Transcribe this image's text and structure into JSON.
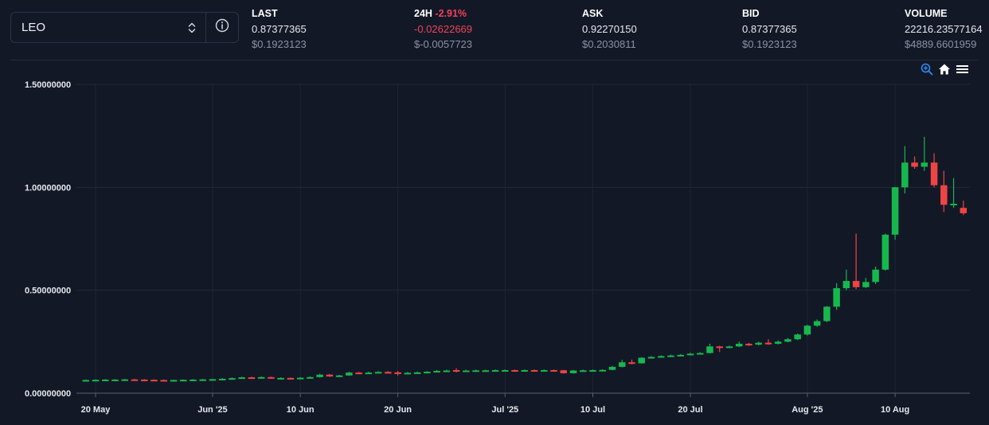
{
  "market_selector": {
    "value": "LEO"
  },
  "stats": [
    {
      "label": "LAST",
      "change": "",
      "value": "0.87377365",
      "usd": "$0.1923123"
    },
    {
      "label": "24H",
      "change": "-2.91%",
      "value": "-0.02622669",
      "usd": "$-0.0057723"
    },
    {
      "label": "ASK",
      "change": "",
      "value": "0.92270150",
      "usd": "$0.2030811"
    },
    {
      "label": "BID",
      "change": "",
      "value": "0.87377365",
      "usd": "$0.1923123"
    },
    {
      "label": "VOLUME",
      "change": "",
      "value": "22216.23577164",
      "usd": "$4889.6601959"
    }
  ],
  "toolbar": {
    "icons": [
      "zoom-in-icon",
      "home-icon",
      "menu-icon"
    ]
  },
  "colors": {
    "up": "#16b84e",
    "down": "#ef4444",
    "background": "#131826",
    "negative_text": "#f0435a",
    "zoom_icon": "#2f8cf0"
  },
  "chart_data": {
    "type": "candlestick",
    "title": "",
    "xlabel": "",
    "ylabel": "",
    "ylim": [
      0,
      1.5
    ],
    "y_ticks": [
      "0.00000000",
      "0.50000000",
      "1.00000000",
      "1.50000000"
    ],
    "x_ticks": [
      {
        "label": "20 May",
        "day": 0
      },
      {
        "label": "Jun '25",
        "day": 12
      },
      {
        "label": "10 Jun",
        "day": 21
      },
      {
        "label": "20 Jun",
        "day": 31
      },
      {
        "label": "Jul '25",
        "day": 42
      },
      {
        "label": "10 Jul",
        "day": 51
      },
      {
        "label": "20 Jul",
        "day": 61
      },
      {
        "label": "Aug '25",
        "day": 73
      },
      {
        "label": "10 Aug",
        "day": 82
      }
    ],
    "candles": [
      [
        -1,
        0.063,
        0.064,
        0.066,
        0.062
      ],
      [
        0,
        0.064,
        0.065,
        0.067,
        0.063
      ],
      [
        1,
        0.065,
        0.066,
        0.068,
        0.064
      ],
      [
        2,
        0.066,
        0.066,
        0.068,
        0.064
      ],
      [
        3,
        0.066,
        0.067,
        0.069,
        0.065
      ],
      [
        4,
        0.067,
        0.066,
        0.069,
        0.064
      ],
      [
        5,
        0.066,
        0.065,
        0.068,
        0.063
      ],
      [
        6,
        0.065,
        0.064,
        0.067,
        0.062
      ],
      [
        7,
        0.064,
        0.063,
        0.066,
        0.061
      ],
      [
        8,
        0.063,
        0.064,
        0.066,
        0.062
      ],
      [
        9,
        0.064,
        0.065,
        0.067,
        0.063
      ],
      [
        10,
        0.065,
        0.066,
        0.068,
        0.063
      ],
      [
        11,
        0.066,
        0.067,
        0.069,
        0.064
      ],
      [
        12,
        0.067,
        0.068,
        0.07,
        0.066
      ],
      [
        13,
        0.068,
        0.07,
        0.073,
        0.066
      ],
      [
        14,
        0.07,
        0.073,
        0.076,
        0.068
      ],
      [
        15,
        0.073,
        0.077,
        0.08,
        0.071
      ],
      [
        16,
        0.077,
        0.075,
        0.08,
        0.073
      ],
      [
        17,
        0.075,
        0.078,
        0.081,
        0.073
      ],
      [
        18,
        0.078,
        0.072,
        0.08,
        0.07
      ],
      [
        19,
        0.072,
        0.074,
        0.077,
        0.07
      ],
      [
        20,
        0.074,
        0.073,
        0.076,
        0.071
      ],
      [
        21,
        0.073,
        0.075,
        0.078,
        0.071
      ],
      [
        22,
        0.075,
        0.078,
        0.081,
        0.073
      ],
      [
        23,
        0.078,
        0.09,
        0.094,
        0.076
      ],
      [
        24,
        0.09,
        0.081,
        0.093,
        0.079
      ],
      [
        25,
        0.081,
        0.086,
        0.089,
        0.079
      ],
      [
        26,
        0.086,
        0.1,
        0.104,
        0.084
      ],
      [
        27,
        0.1,
        0.098,
        0.103,
        0.095
      ],
      [
        28,
        0.098,
        0.1,
        0.104,
        0.096
      ],
      [
        29,
        0.1,
        0.103,
        0.106,
        0.098
      ],
      [
        30,
        0.103,
        0.101,
        0.107,
        0.099
      ],
      [
        31,
        0.101,
        0.096,
        0.108,
        0.085
      ],
      [
        32,
        0.096,
        0.099,
        0.103,
        0.094
      ],
      [
        33,
        0.099,
        0.101,
        0.105,
        0.097
      ],
      [
        34,
        0.101,
        0.104,
        0.107,
        0.099
      ],
      [
        35,
        0.104,
        0.108,
        0.112,
        0.102
      ],
      [
        36,
        0.108,
        0.11,
        0.114,
        0.105
      ],
      [
        37,
        0.112,
        0.108,
        0.121,
        0.101
      ],
      [
        38,
        0.108,
        0.11,
        0.114,
        0.106
      ],
      [
        39,
        0.11,
        0.111,
        0.114,
        0.108
      ],
      [
        40,
        0.111,
        0.111,
        0.114,
        0.108
      ],
      [
        41,
        0.111,
        0.112,
        0.115,
        0.109
      ],
      [
        42,
        0.112,
        0.112,
        0.115,
        0.109
      ],
      [
        43,
        0.112,
        0.111,
        0.115,
        0.108
      ],
      [
        44,
        0.111,
        0.112,
        0.115,
        0.109
      ],
      [
        45,
        0.112,
        0.111,
        0.115,
        0.108
      ],
      [
        46,
        0.111,
        0.112,
        0.115,
        0.109
      ],
      [
        47,
        0.112,
        0.111,
        0.115,
        0.108
      ],
      [
        48,
        0.111,
        0.097,
        0.113,
        0.095
      ],
      [
        49,
        0.097,
        0.11,
        0.113,
        0.095
      ],
      [
        50,
        0.11,
        0.111,
        0.114,
        0.108
      ],
      [
        51,
        0.111,
        0.112,
        0.115,
        0.109
      ],
      [
        52,
        0.112,
        0.113,
        0.116,
        0.11
      ],
      [
        53,
        0.113,
        0.128,
        0.132,
        0.111
      ],
      [
        54,
        0.128,
        0.15,
        0.162,
        0.125
      ],
      [
        55,
        0.15,
        0.145,
        0.163,
        0.14
      ],
      [
        56,
        0.145,
        0.172,
        0.175,
        0.143
      ],
      [
        57,
        0.172,
        0.176,
        0.18,
        0.17
      ],
      [
        58,
        0.176,
        0.18,
        0.184,
        0.174
      ],
      [
        59,
        0.18,
        0.183,
        0.187,
        0.177
      ],
      [
        60,
        0.183,
        0.186,
        0.19,
        0.18
      ],
      [
        61,
        0.186,
        0.192,
        0.196,
        0.183
      ],
      [
        62,
        0.192,
        0.195,
        0.199,
        0.19
      ],
      [
        63,
        0.195,
        0.227,
        0.24,
        0.193
      ],
      [
        64,
        0.227,
        0.222,
        0.23,
        0.2
      ],
      [
        65,
        0.222,
        0.227,
        0.231,
        0.219
      ],
      [
        66,
        0.227,
        0.24,
        0.25,
        0.224
      ],
      [
        67,
        0.24,
        0.236,
        0.244,
        0.23
      ],
      [
        68,
        0.236,
        0.245,
        0.25,
        0.232
      ],
      [
        69,
        0.245,
        0.24,
        0.262,
        0.235
      ],
      [
        70,
        0.24,
        0.25,
        0.256,
        0.237
      ],
      [
        71,
        0.25,
        0.262,
        0.268,
        0.247
      ],
      [
        72,
        0.262,
        0.285,
        0.29,
        0.258
      ],
      [
        73,
        0.285,
        0.328,
        0.332,
        0.28
      ],
      [
        74,
        0.328,
        0.35,
        0.358,
        0.322
      ],
      [
        75,
        0.35,
        0.42,
        0.423,
        0.345
      ],
      [
        76,
        0.42,
        0.51,
        0.535,
        0.405
      ],
      [
        77,
        0.51,
        0.545,
        0.6,
        0.5
      ],
      [
        78,
        0.545,
        0.515,
        0.775,
        0.505
      ],
      [
        79,
        0.515,
        0.54,
        0.56,
        0.51
      ],
      [
        80,
        0.54,
        0.6,
        0.615,
        0.53
      ],
      [
        81,
        0.6,
        0.77,
        0.775,
        0.595
      ],
      [
        82,
        0.77,
        1.0,
        1.002,
        0.745
      ],
      [
        83,
        1.0,
        1.12,
        1.2,
        0.97
      ],
      [
        84,
        1.12,
        1.1,
        1.15,
        1.09
      ],
      [
        85,
        1.1,
        1.12,
        1.245,
        1.08
      ],
      [
        86,
        1.12,
        1.01,
        1.165,
        1.0
      ],
      [
        87,
        1.01,
        0.915,
        1.08,
        0.88
      ],
      [
        88,
        0.915,
        0.92,
        1.045,
        0.9
      ],
      [
        89,
        0.9,
        0.874,
        0.935,
        0.865
      ]
    ]
  }
}
